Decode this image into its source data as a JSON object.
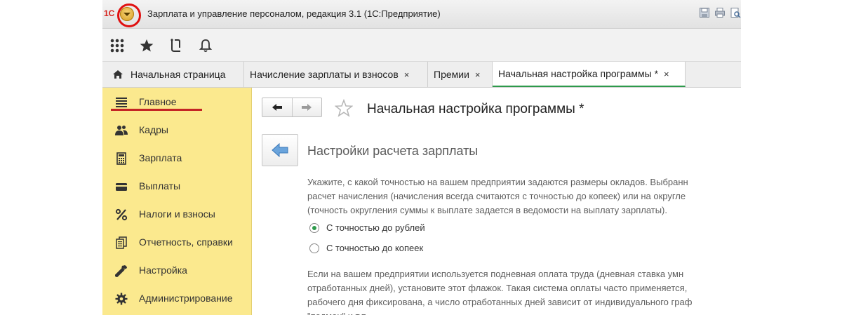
{
  "window": {
    "logo": "1С",
    "title": "Зарплата и управление персоналом, редакция 3.1  (1С:Предприятие)"
  },
  "tabs": [
    {
      "label": "Начальная страница",
      "closable": false
    },
    {
      "label": "Начисление зарплаты и взносов",
      "closable": true
    },
    {
      "label": "Премии",
      "closable": true
    },
    {
      "label": "Начальная настройка программы *",
      "closable": true,
      "active": true
    }
  ],
  "tab_close_glyph": "×",
  "sidebar": {
    "items": [
      {
        "label": "Главное",
        "icon": "menu-lines-icon",
        "selected": true
      },
      {
        "label": "Кадры",
        "icon": "people-icon"
      },
      {
        "label": "Зарплата",
        "icon": "calculator-icon"
      },
      {
        "label": "Выплаты",
        "icon": "wallet-icon"
      },
      {
        "label": "Налоги и взносы",
        "icon": "percent-icon"
      },
      {
        "label": "Отчетность, справки",
        "icon": "documents-icon"
      },
      {
        "label": "Настройка",
        "icon": "wrench-icon"
      },
      {
        "label": "Администрирование",
        "icon": "gear-icon"
      }
    ]
  },
  "content": {
    "form_title": "Начальная настройка программы *",
    "section_title": "Настройки расчета зарплаты",
    "para1": [
      "Укажите, с какой точностью на вашем предприятии задаются размеры окладов. Выбранн",
      "расчет начисления (начисления всегда считаются с точностью до копеек) или на округле",
      "(точность округления суммы к выплате задается в ведомости на выплату зарплаты)."
    ],
    "radios": [
      {
        "label": "С точностью до рублей",
        "checked": true
      },
      {
        "label": "С точностью до копеек",
        "checked": false
      }
    ],
    "para2": [
      "Если на вашем предприятии используется подневная оплата труда (дневная ставка умн",
      "отработанных дней), установите этот флажок. Такая система оплаты часто применяется,",
      "рабочего дня фиксирована, а число отработанных дней зависит от индивидуального граф",
      "\"подмен\" и т.п."
    ]
  },
  "colors": {
    "sidebar_bg": "#fbe98e",
    "accent_green": "#2d9a4b",
    "highlight_red": "#e01010",
    "menu_button": "#d59a1a"
  }
}
